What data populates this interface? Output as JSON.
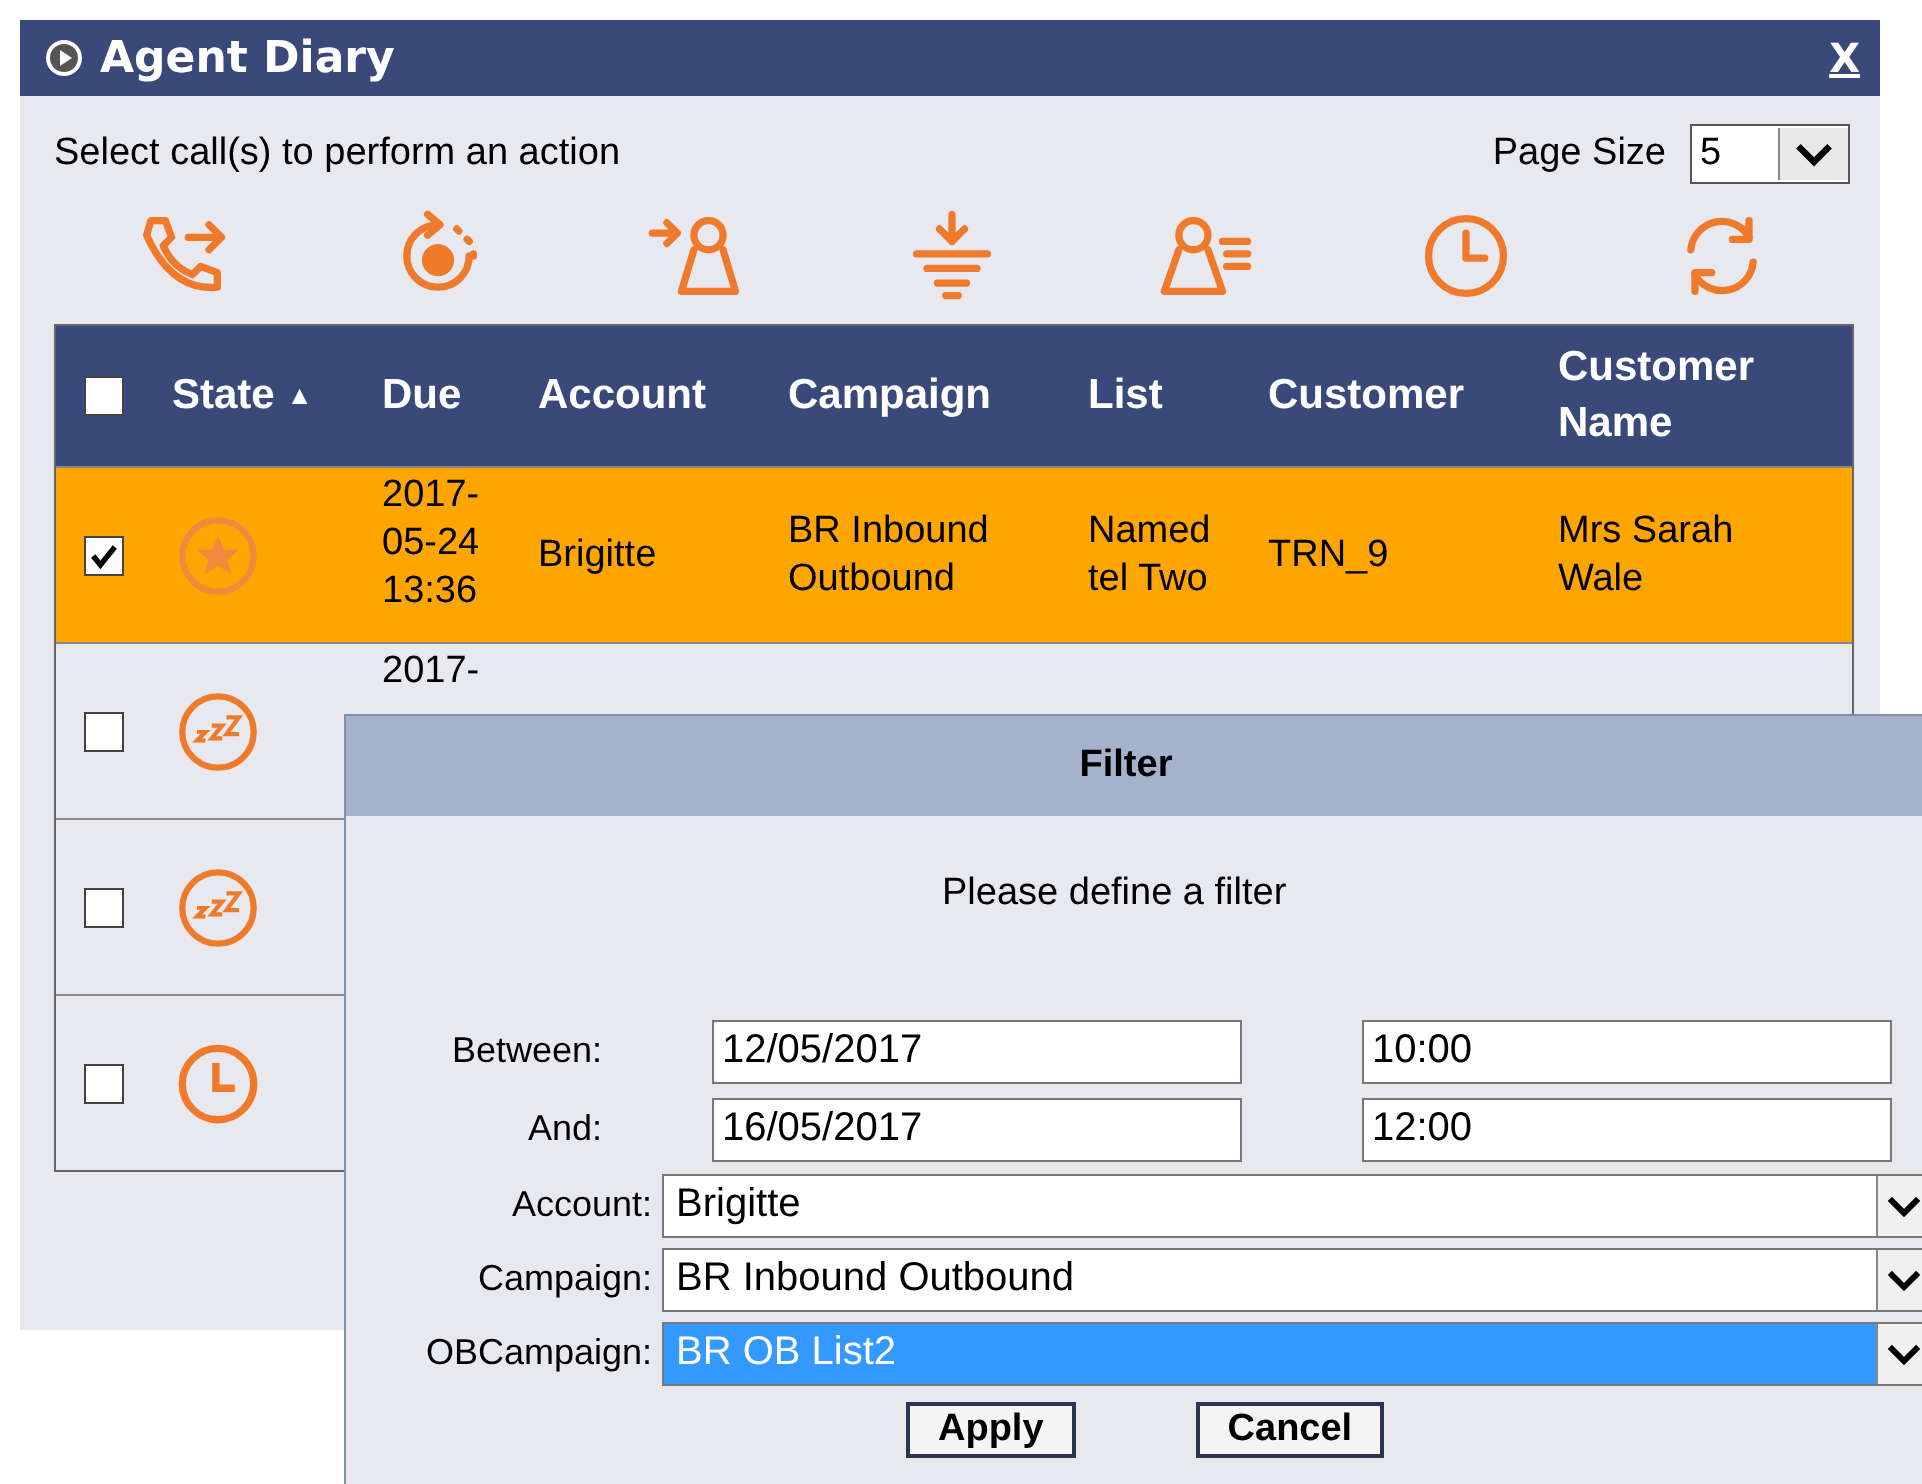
{
  "window": {
    "title": "Agent Diary",
    "close": "X"
  },
  "instruction": "Select call(s) to perform an action",
  "page_size": {
    "label": "Page Size",
    "value": "5"
  },
  "toolbar": [
    {
      "kind": "transfer"
    },
    {
      "kind": "reschedule"
    },
    {
      "kind": "assign"
    },
    {
      "kind": "filter"
    },
    {
      "kind": "agent-list"
    },
    {
      "kind": "clock"
    },
    {
      "kind": "refresh"
    }
  ],
  "table": {
    "select_all": {
      "checked": false
    },
    "columns": [
      {
        "label": "State",
        "sort": "▲"
      },
      {
        "label": "Due"
      },
      {
        "label": "Account"
      },
      {
        "label": "Campaign"
      },
      {
        "label": "List"
      },
      {
        "label": "Customer"
      },
      {
        "label": "Customer Name"
      }
    ],
    "rows": [
      {
        "selected": true,
        "checked": true,
        "kind": "star",
        "due": "2017-\n05-24\n13:36",
        "account": "Brigitte",
        "campaign": "BR Inbound Outbound",
        "list": "Named tel Two",
        "customer": "TRN_9",
        "customer_name": "Mrs Sarah Wale"
      },
      {
        "selected": false,
        "checked": false,
        "kind": "sleep",
        "due": "2017-"
      },
      {
        "selected": false,
        "checked": false,
        "kind": "sleep"
      },
      {
        "selected": false,
        "checked": false,
        "kind": "clock"
      }
    ]
  },
  "filter_dialog": {
    "title": "Filter",
    "prompt": "Please define a filter",
    "dates": [
      {
        "label": "Between:",
        "date": "12/05/2017",
        "time": "10:00"
      },
      {
        "label": "And:",
        "date": "16/05/2017",
        "time": "12:00"
      }
    ],
    "selects": [
      {
        "label": "Account:",
        "value": "Brigitte",
        "highlighted": false
      },
      {
        "label": "Campaign:",
        "value": "BR Inbound Outbound",
        "highlighted": false
      },
      {
        "label": "OBCampaign:",
        "value": "BR OB List2",
        "highlighted": true
      }
    ],
    "buttons": [
      "Apply",
      "Cancel"
    ]
  }
}
